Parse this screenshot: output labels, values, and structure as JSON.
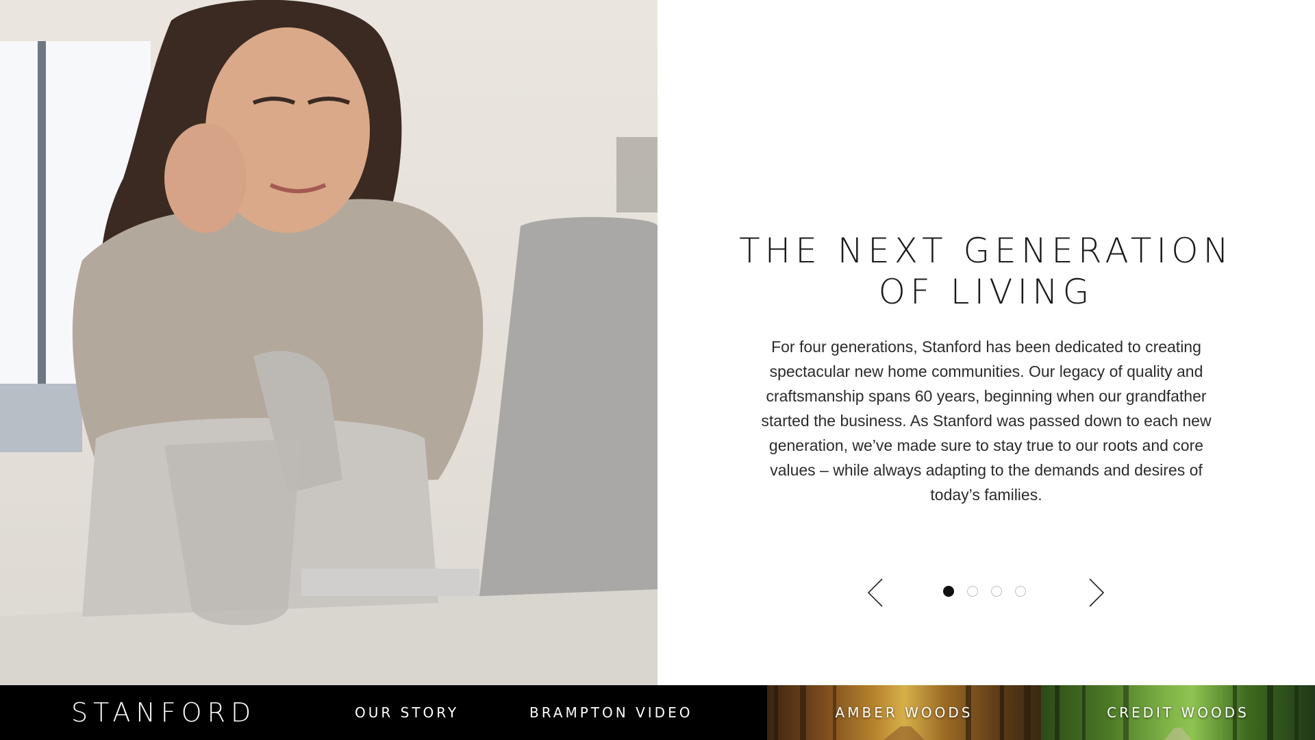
{
  "slide": {
    "title_lines": [
      "THE NEXT GENERATION",
      "OF LIVING"
    ],
    "body_lines": [
      "For four generations, Stanford has been dedicated to creating",
      "spectacular new home communities. Our legacy of quality and",
      "craftsmanship spans 60 years, beginning when our grandfather",
      "started the business. As Stanford was passed down to each new",
      "generation, we’ve made sure to stay true to our roots and core",
      "values – while always adapting to the demands and desires of",
      "today’s families."
    ],
    "prev_icon": "chevron-left-icon",
    "next_icon": "chevron-right-icon",
    "pagination": {
      "total": 4,
      "active": 1
    }
  },
  "navbar": {
    "logo": "STANFORD",
    "links": [
      "OUR STORY",
      "BRAMPTON VIDEO"
    ],
    "tiles": [
      "AMBER WOODS",
      "CREDIT WOODS"
    ]
  },
  "colors": {
    "navbar_bg": "#000000",
    "text_dark": "#1a1a1a",
    "dot_active": "#111111",
    "dot_inactive_border": "#bdbdbd"
  }
}
